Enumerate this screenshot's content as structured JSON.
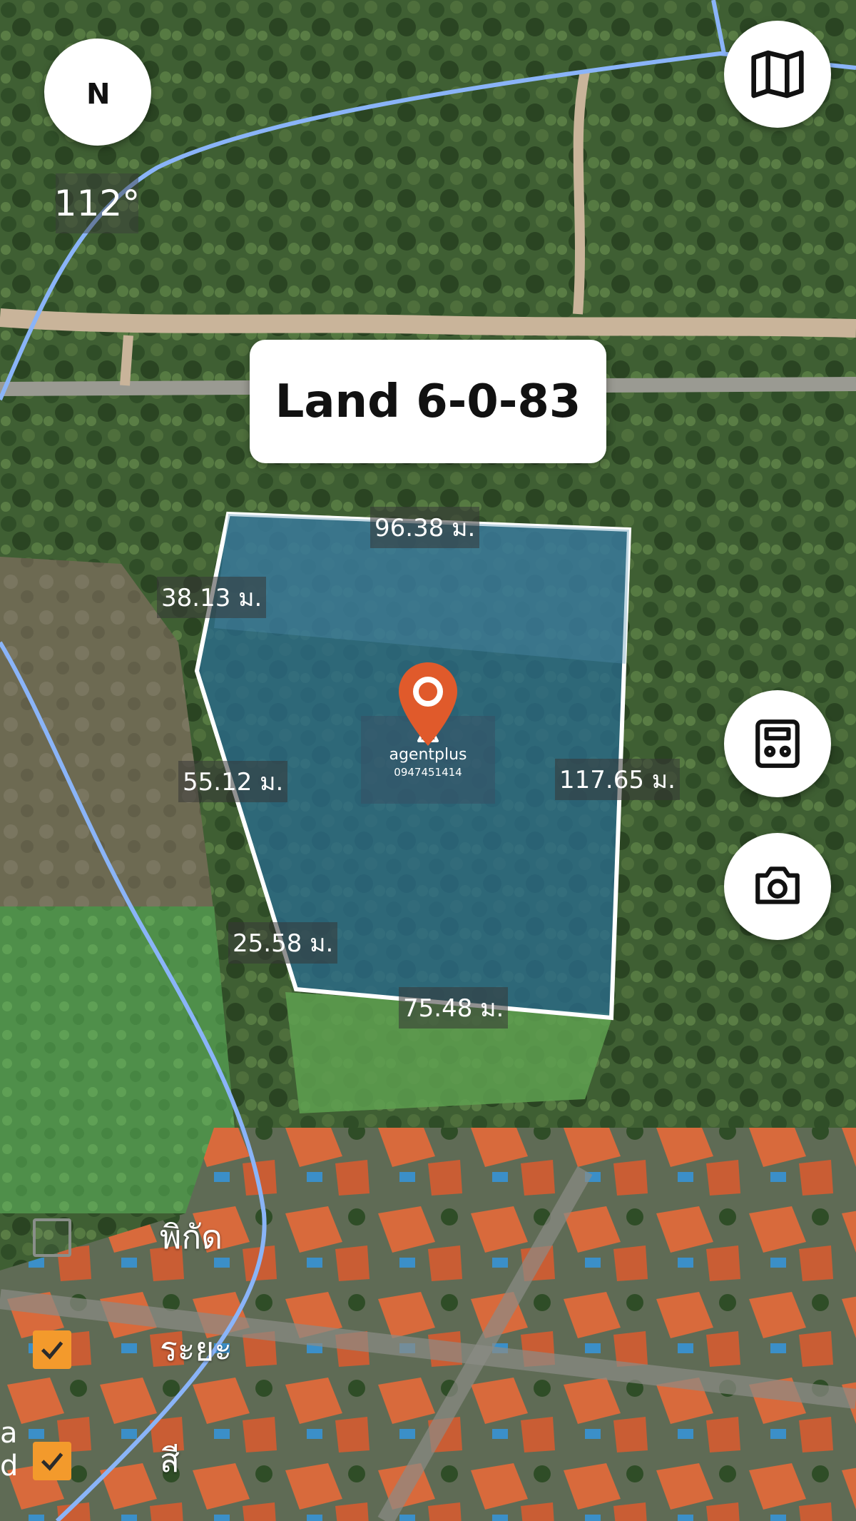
{
  "map": {
    "compass_label": "N",
    "bearing": "112°",
    "title": "Land 6-0-83",
    "measurements": {
      "top": "96.38 ม.",
      "left_upper": "38.13 ม.",
      "left_mid": "55.12 ม.",
      "right": "117.65 ม.",
      "left_lower": "25.58 ม.",
      "bottom": "75.48 ม."
    },
    "watermark": {
      "name": "agentplus",
      "phone": "0947451414"
    }
  },
  "buttons": {
    "compass": "compass-icon",
    "map_layers": "map-icon",
    "calculator": "calculator-icon",
    "camera": "camera-icon"
  },
  "layers": [
    {
      "label": "พิกัด",
      "checked": false
    },
    {
      "label": "ระยะ",
      "checked": true
    },
    {
      "label": "สี",
      "checked": true
    }
  ],
  "edge_text": "a\nd",
  "colors": {
    "plot_fill": "#2a6a8a",
    "plot_border": "#ffffff",
    "pin": "#e05a2b",
    "checkbox_on": "#f39a2c",
    "road_line": "#8ab4f8"
  }
}
